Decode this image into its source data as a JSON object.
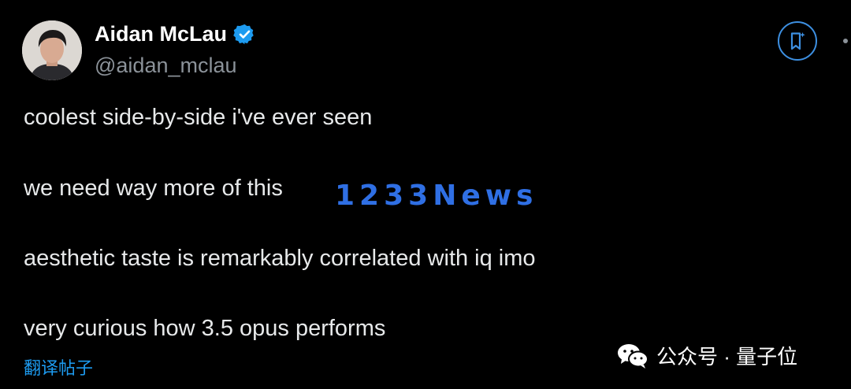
{
  "author": {
    "display_name": "Aidan McLau",
    "handle": "@aidan_mclau",
    "verified": true
  },
  "post": {
    "lines": [
      "coolest side-by-side i've ever seen",
      "we need way more of this",
      "aesthetic taste is remarkably correlated with iq imo",
      "very curious how 3.5 opus performs"
    ],
    "translate_label": "翻译帖子"
  },
  "overlays": {
    "watermark_text": "1233News",
    "wechat_label": "公众号 · 量子位"
  },
  "icons": {
    "verified": "verified-badge-icon",
    "bookmark": "grok-bookmark-icon",
    "more": "more-dots-icon",
    "wechat": "wechat-icon"
  },
  "colors": {
    "background": "#000000",
    "text": "#e7e9ea",
    "handle": "#8b9299",
    "link": "#1d9bf0",
    "accent_ring": "#3d8fe0",
    "watermark": "#2f6fe4"
  }
}
